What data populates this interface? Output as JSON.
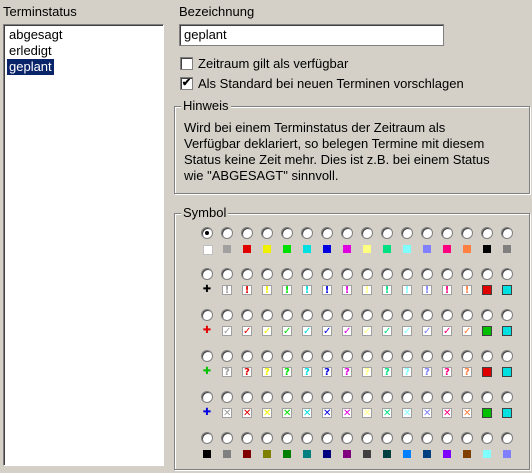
{
  "status_list": {
    "label": "Terminstatus",
    "items": [
      "abgesagt",
      "erledigt",
      "geplant"
    ],
    "selected_index": 2
  },
  "name": {
    "label": "Bezeichnung",
    "value": "geplant"
  },
  "checkboxes": [
    {
      "label": "Zeitraum gilt als verfügbar",
      "checked": false
    },
    {
      "label": "Als Standard bei neuen Terminen vorschlagen",
      "checked": true
    }
  ],
  "hint": {
    "title": "Hinweis",
    "lines": [
      "Wird bei einem Terminstatus der Zeitraum als",
      "Verfügbar deklariert, so belegen Termine mit diesem",
      "Status keine Zeit mehr. Dies ist z.B. bei einem Status",
      "wie \"ABGESAGT\" sinnvoll."
    ]
  },
  "symbol": {
    "title": "Symbol",
    "selected": [
      0,
      0
    ],
    "colors": [
      "#ffffff",
      "#a0a0a0",
      "#e00000",
      "#f0f000",
      "#00e000",
      "#00e0e0",
      "#0000e0",
      "#e000e0",
      "#ffff80",
      "#00e080",
      "#80ffff",
      "#8080ff",
      "#ff0080",
      "#ff8040",
      "#000000",
      "#808080"
    ],
    "rows": [
      {
        "kind": "square",
        "icon": "color-square-icon"
      },
      {
        "kind": "exclaim",
        "icon": "exclamation-icon",
        "glyph": "!"
      },
      {
        "kind": "check",
        "icon": "checkmark-icon",
        "glyph": "✓"
      },
      {
        "kind": "question",
        "icon": "question-icon",
        "glyph": "?"
      },
      {
        "kind": "cross",
        "icon": "cross-icon",
        "glyph": "✕"
      },
      {
        "kind": "dark",
        "icon": "dark-square-icon"
      }
    ],
    "row_special": {
      "exclaim_first": "✚",
      "question_first": "✚",
      "cross_first": "✚",
      "check_first": "✚"
    },
    "dark_colors": [
      "#000000",
      "#808080",
      "#800000",
      "#808000",
      "#008000",
      "#008080",
      "#000080",
      "#800080",
      "#404040",
      "#004040",
      "#0080ff",
      "#004080",
      "#8000ff",
      "#804000",
      "#80ffff",
      "#8080ff"
    ]
  }
}
